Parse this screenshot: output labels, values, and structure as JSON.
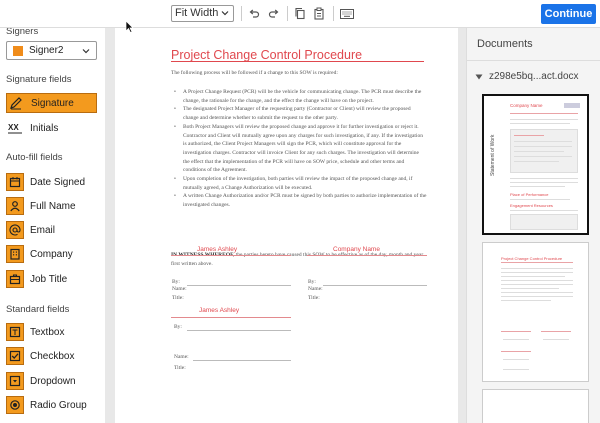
{
  "toolbar": {
    "zoom": "Fit Width",
    "continue_label": "Continue"
  },
  "sidebar": {
    "signers_heading": "Signers",
    "signer": "Signer2",
    "signer_color": "#f08c1a",
    "signature_fields_heading": "Signature fields",
    "signature_fields": [
      {
        "label": "Signature",
        "icon": "pen-icon"
      },
      {
        "label": "Initials",
        "icon": "initials-icon"
      }
    ],
    "autofill_heading": "Auto-fill fields",
    "autofill_fields": [
      {
        "label": "Date Signed",
        "icon": "calendar-icon"
      },
      {
        "label": "Full Name",
        "icon": "person-icon"
      },
      {
        "label": "Email",
        "icon": "at-icon"
      },
      {
        "label": "Company",
        "icon": "building-icon"
      },
      {
        "label": "Job Title",
        "icon": "briefcase-icon"
      }
    ],
    "standard_heading": "Standard fields",
    "standard_fields": [
      {
        "label": "Textbox",
        "icon": "textbox-icon"
      },
      {
        "label": "Checkbox",
        "icon": "checkbox-icon"
      },
      {
        "label": "Dropdown",
        "icon": "dropdown-icon"
      },
      {
        "label": "Radio Group",
        "icon": "radio-icon"
      }
    ]
  },
  "document": {
    "title": "Project Change Control Procedure",
    "intro": "The following process will be followed if a change to this SOW is required:",
    "bullets": [
      "A Project Change Request (PCR) will be the vehicle for communicating change. The PCR must describe the change, the rationale for the change, and the effect the change will have on the project.",
      "The designated Project Manager of the requesting party (Contractor or Client) will review the proposed change and determine whether to submit the request to the other party.",
      "Both Project Managers will review the proposed change and approve it for further investigation or reject it. Contractor and Client will mutually agree upon any charges for such investigation, if any. If the investigation is authorized, the Client Project Managers will sign the PCR, which will constitute approval for the investigation charges. Contractor will invoice Client for any such charges. The investigation will determine the effect that the implementation of the PCR will have on SOW price, schedule and other terms and conditions of the Agreement.",
      "Upon completion of the investigation, both parties will review the impact of the proposed change and, if mutually agreed, a Change Authorization will be executed.",
      "A written Change Authorization and/or PCR must be signed by both parties to authorize implementation of the investigated changes."
    ],
    "witness_bold": "IN WITNESS WHEREOF,",
    "witness_rest": " the parties hereto have caused this SOW to be effective as of the day, month and year first written above.",
    "sig_name_1": "James Ashley",
    "sig_company": "Company Name",
    "sig_name_2": "James Ashley",
    "label_by": "By:",
    "label_name": "Name:",
    "label_title": "Title:"
  },
  "docs_panel": {
    "title": "Documents",
    "file_name": "z298e5bq...act.docx",
    "thumb1_heading": "Company Name",
    "thumb1_section1": "Place of Performance",
    "thumb1_section2": "Engagement Resources",
    "thumb1_side_text": "Statement of Work",
    "thumb2_title": "Project Change Control Procedure"
  }
}
